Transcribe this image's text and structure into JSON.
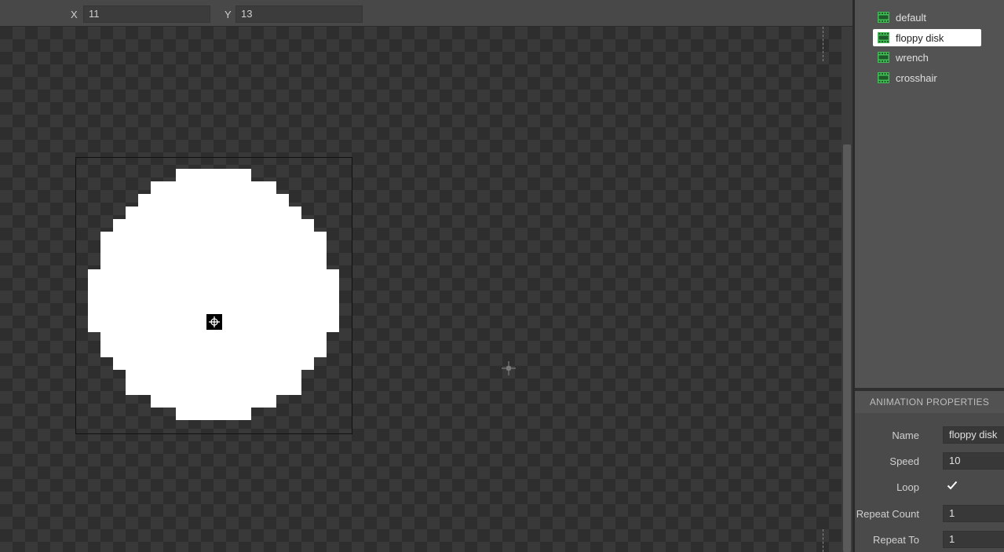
{
  "coords": {
    "x_label": "X",
    "x_value": "11",
    "y_label": "Y",
    "y_value": "13"
  },
  "animations": [
    {
      "label": "default",
      "selected": false
    },
    {
      "label": "floppy disk",
      "selected": true
    },
    {
      "label": "wrench",
      "selected": false
    },
    {
      "label": "crosshair",
      "selected": false
    }
  ],
  "properties": {
    "header": "ANIMATION PROPERTIES",
    "name_label": "Name",
    "name_value": "floppy disk",
    "speed_label": "Speed",
    "speed_value": "10",
    "loop_label": "Loop",
    "loop_checked": true,
    "repeat_count_label": "Repeat Count",
    "repeat_count_value": "1",
    "repeat_to_label": "Repeat To",
    "repeat_to_value": "1"
  },
  "icons": {
    "animation_item": "film-strip-icon",
    "origin_marker": "crosshair-target-icon",
    "mouse_cursor": "move-cursor-icon",
    "loop_checkbox": "checkmark-icon"
  },
  "colors": {
    "film_icon": "#3fbf54",
    "sprite_fill": "#ffffff",
    "panel_bg": "#535353",
    "canvas_dark": "#2e2e2e",
    "canvas_light": "#393939"
  }
}
